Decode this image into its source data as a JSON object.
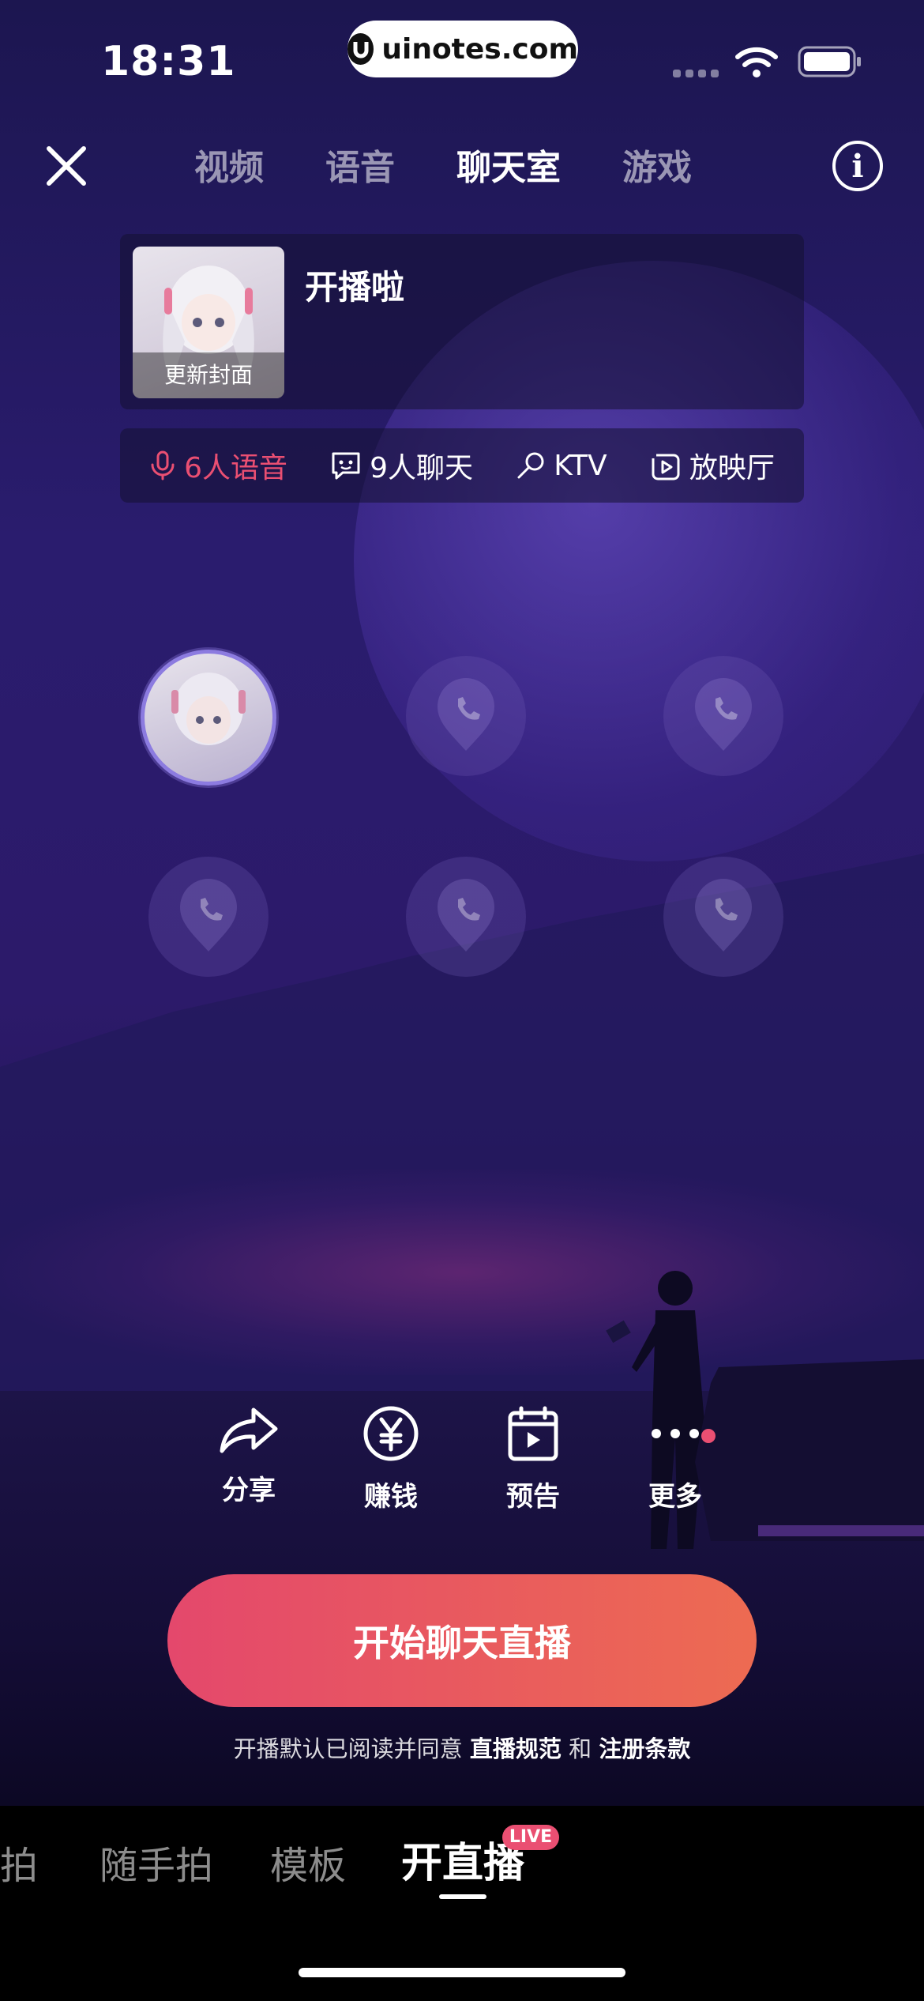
{
  "status_bar": {
    "time": "18:31",
    "watermark": "uinotes.com"
  },
  "header": {
    "tabs": [
      {
        "label": "视频",
        "active": false
      },
      {
        "label": "语音",
        "active": false
      },
      {
        "label": "聊天室",
        "active": true
      },
      {
        "label": "游戏",
        "active": false
      }
    ],
    "close_icon": "close-icon",
    "info_icon": "info-icon",
    "info_glyph": "i"
  },
  "room_card": {
    "cover_label": "更新封面",
    "title": "开播啦"
  },
  "modes": [
    {
      "label": "6人语音",
      "icon": "mic-icon",
      "active": true
    },
    {
      "label": "9人聊天",
      "icon": "chat-icon",
      "active": false
    },
    {
      "label": "KTV",
      "icon": "microphone-icon",
      "active": false
    },
    {
      "label": "放映厅",
      "icon": "play-icon",
      "active": false
    }
  ],
  "actions": [
    {
      "label": "分享",
      "icon": "share-icon"
    },
    {
      "label": "赚钱",
      "icon": "yuan-icon"
    },
    {
      "label": "预告",
      "icon": "calendar-icon"
    },
    {
      "label": "更多",
      "icon": "more-icon"
    }
  ],
  "start_button": {
    "label": "开始聊天直播"
  },
  "agreement": {
    "prefix": "开播默认已阅读并同意 ",
    "link1": "直播规范",
    "middle": " 和 ",
    "link2": "注册条款"
  },
  "bottom_nav": {
    "items": [
      {
        "label": "拍",
        "active": false
      },
      {
        "label": "随手拍",
        "active": false
      },
      {
        "label": "模板",
        "active": false
      },
      {
        "label": "开直播",
        "active": true
      }
    ],
    "live_badge": "LIVE"
  },
  "colors": {
    "accent": "#ea4f72",
    "button_gradient_start": "#e4486c",
    "button_gradient_end": "#ed6b52"
  }
}
